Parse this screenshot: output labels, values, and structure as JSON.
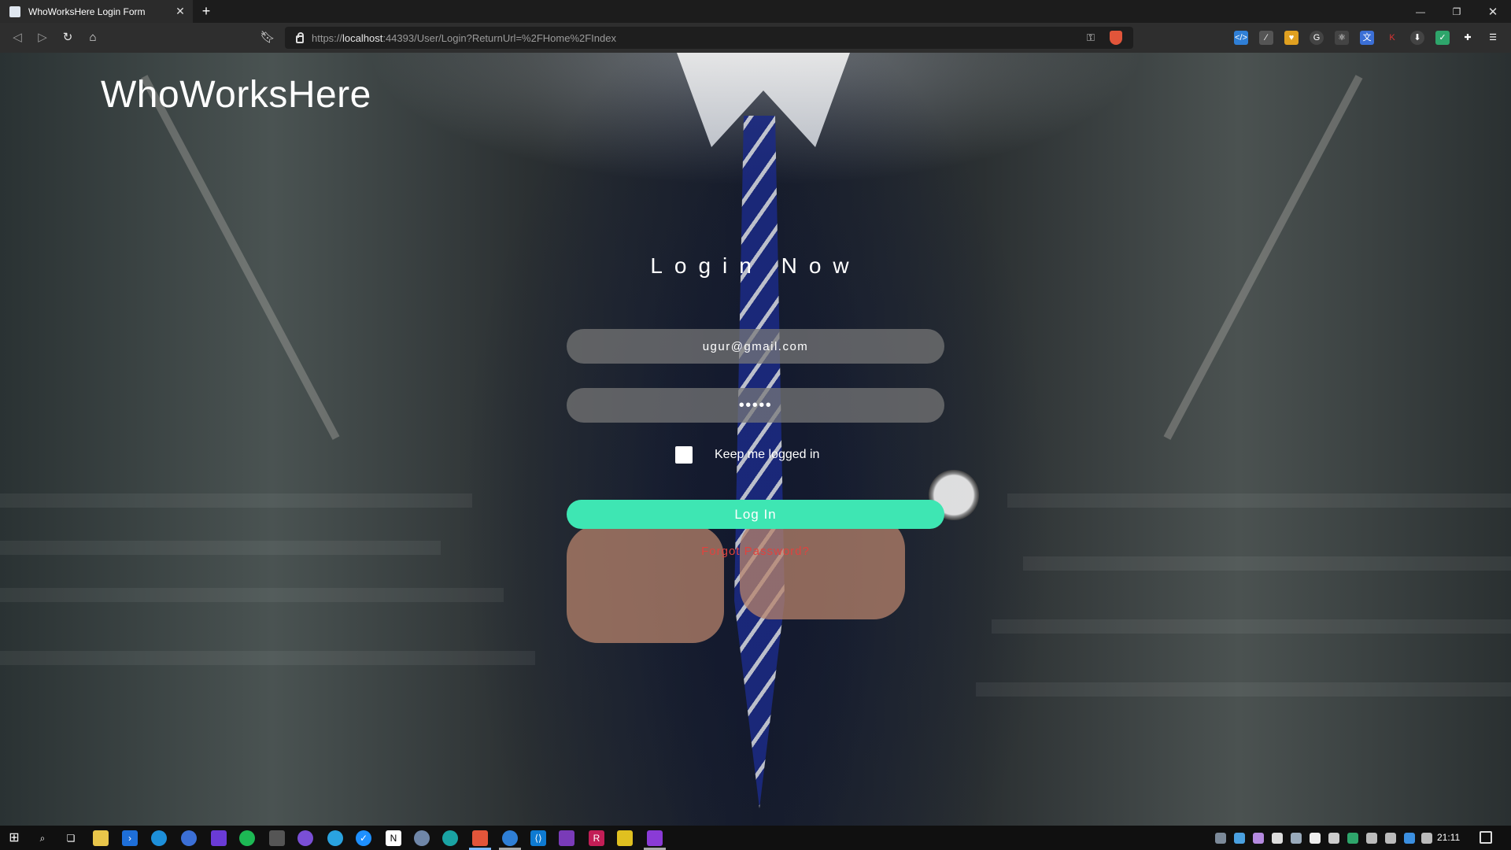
{
  "browser": {
    "tab_title": "WhoWorksHere Login Form",
    "url_scheme": "https://",
    "url_host": "localhost",
    "url_path": ":44393/User/Login?ReturnUrl=%2FHome%2FIndex"
  },
  "page": {
    "brand": "WhoWorksHere",
    "login_title": "Login Now",
    "email_value": "ugur@gmail.com",
    "password_value": "•••••",
    "remember_label": "Keep me logged in",
    "login_button": "Log In",
    "forgot_link": "Forgot Password?"
  },
  "taskbar": {
    "clock": "21:11"
  },
  "colors": {
    "accent": "#3ee6b3",
    "forgot_link": "#e0433f"
  }
}
